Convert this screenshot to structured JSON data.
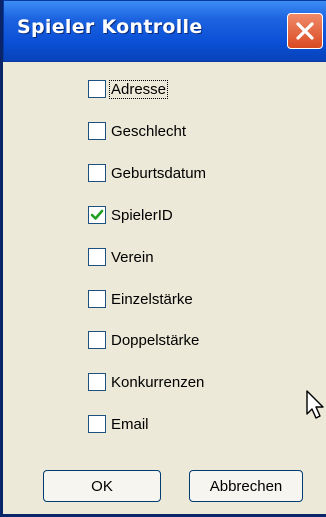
{
  "window": {
    "title": "Spieler Kontrolle",
    "close_icon": "close-icon"
  },
  "checkboxes": [
    {
      "label": "Adresse",
      "checked": false,
      "focused": true
    },
    {
      "label": "Geschlecht",
      "checked": false
    },
    {
      "label": "Geburtsdatum",
      "checked": false
    },
    {
      "label": "SpielerID",
      "checked": true
    },
    {
      "label": "Verein",
      "checked": false
    },
    {
      "label": "Einzelstärke",
      "checked": false
    },
    {
      "label": "Doppelstärke",
      "checked": false
    },
    {
      "label": "Konkurrenzen",
      "checked": false
    },
    {
      "label": "Email",
      "checked": false
    }
  ],
  "buttons": {
    "ok": "OK",
    "cancel": "Abbrechen"
  },
  "colors": {
    "titlebar": "#0a4fd6",
    "checkmark": "#21a121",
    "close": "#d94a22"
  }
}
